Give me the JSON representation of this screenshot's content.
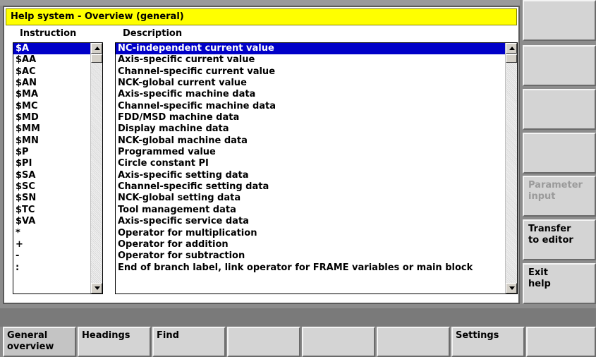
{
  "dialog": {
    "title": "Help system - Overview (general)",
    "col_instruction": "Instruction",
    "col_description": "Description"
  },
  "rows": [
    {
      "instr": "$A",
      "desc": "NC-independent current value"
    },
    {
      "instr": "$AA",
      "desc": "Axis-specific current value"
    },
    {
      "instr": "$AC",
      "desc": "Channel-specific current value"
    },
    {
      "instr": "$AN",
      "desc": "NCK-global current value"
    },
    {
      "instr": "$MA",
      "desc": "Axis-specific machine data"
    },
    {
      "instr": "$MC",
      "desc": "Channel-specific machine data"
    },
    {
      "instr": "$MD",
      "desc": "FDD/MSD machine data"
    },
    {
      "instr": "$MM",
      "desc": "Display machine data"
    },
    {
      "instr": "$MN",
      "desc": "NCK-global machine data"
    },
    {
      "instr": "$P",
      "desc": "Programmed value"
    },
    {
      "instr": "$PI",
      "desc": "Circle constant PI"
    },
    {
      "instr": "$SA",
      "desc": "Axis-specific setting data"
    },
    {
      "instr": "$SC",
      "desc": "Channel-specific setting data"
    },
    {
      "instr": "$SN",
      "desc": "NCK-global setting data"
    },
    {
      "instr": "$TC",
      "desc": "Tool management data"
    },
    {
      "instr": "$VA",
      "desc": "Axis-specific service data"
    },
    {
      "instr": "*",
      "desc": "Operator for multiplication"
    },
    {
      "instr": "+",
      "desc": "Operator for addition"
    },
    {
      "instr": "-",
      "desc": "Operator for subtraction"
    },
    {
      "instr": ":",
      "desc": "End of branch label, link operator for FRAME variables or main block"
    }
  ],
  "selected_row": 0,
  "vertical_softkeys": [
    {
      "label": "",
      "disabled": false
    },
    {
      "label": "",
      "disabled": false
    },
    {
      "label": "",
      "disabled": false
    },
    {
      "label": "",
      "disabled": false
    },
    {
      "label": "Parameter\ninput",
      "disabled": true
    },
    {
      "label": "Transfer\nto editor",
      "disabled": false
    },
    {
      "label": "Exit\nhelp",
      "disabled": false
    }
  ],
  "horizontal_softkeys": [
    {
      "label": "General\noverview",
      "active": true
    },
    {
      "label": "Headings",
      "active": false
    },
    {
      "label": "Find",
      "active": false
    },
    {
      "label": "",
      "active": false
    },
    {
      "label": "",
      "active": false
    },
    {
      "label": "",
      "active": false
    },
    {
      "label": "Settings",
      "active": false
    },
    {
      "label": "",
      "active": false
    }
  ],
  "colors": {
    "title_bg": "#ffff00",
    "selection_bg": "#0000c8",
    "disabled_text": "#9a9a9a"
  }
}
